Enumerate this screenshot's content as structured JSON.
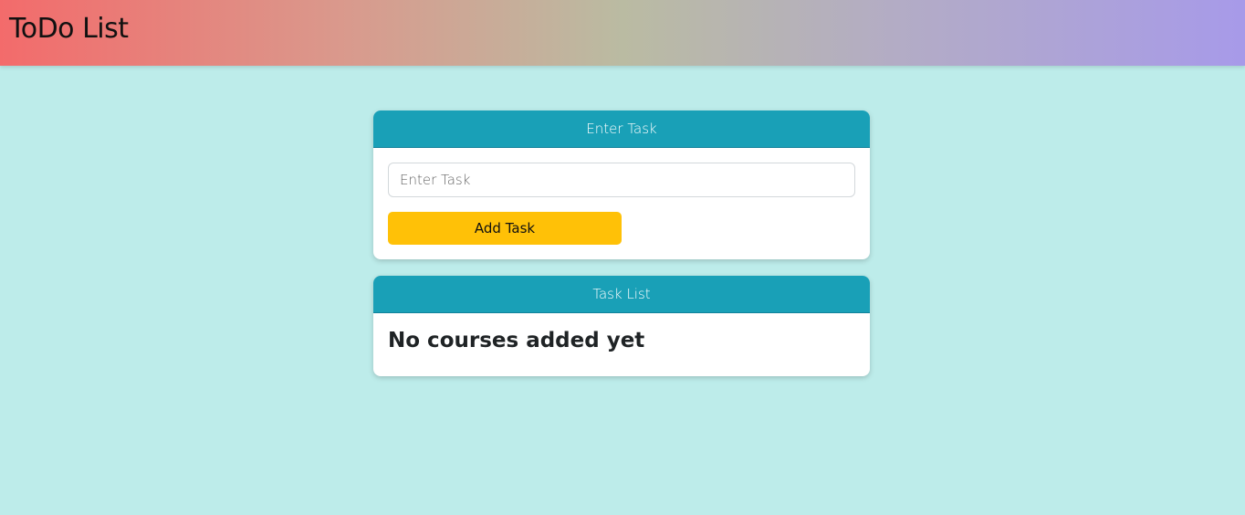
{
  "header": {
    "title": "ToDo List"
  },
  "entry_card": {
    "header": "Enter Task",
    "input_placeholder": "Enter Task",
    "input_value": "",
    "add_button_label": "Add Task"
  },
  "list_card": {
    "header": "Task List",
    "empty_message": "No courses added yet"
  },
  "colors": {
    "page_background": "#bdecea",
    "card_header": "#19a0b7",
    "add_button": "#ffc107",
    "header_gradient": [
      "#f36b6b",
      "#babba2",
      "#a79ae9"
    ]
  }
}
